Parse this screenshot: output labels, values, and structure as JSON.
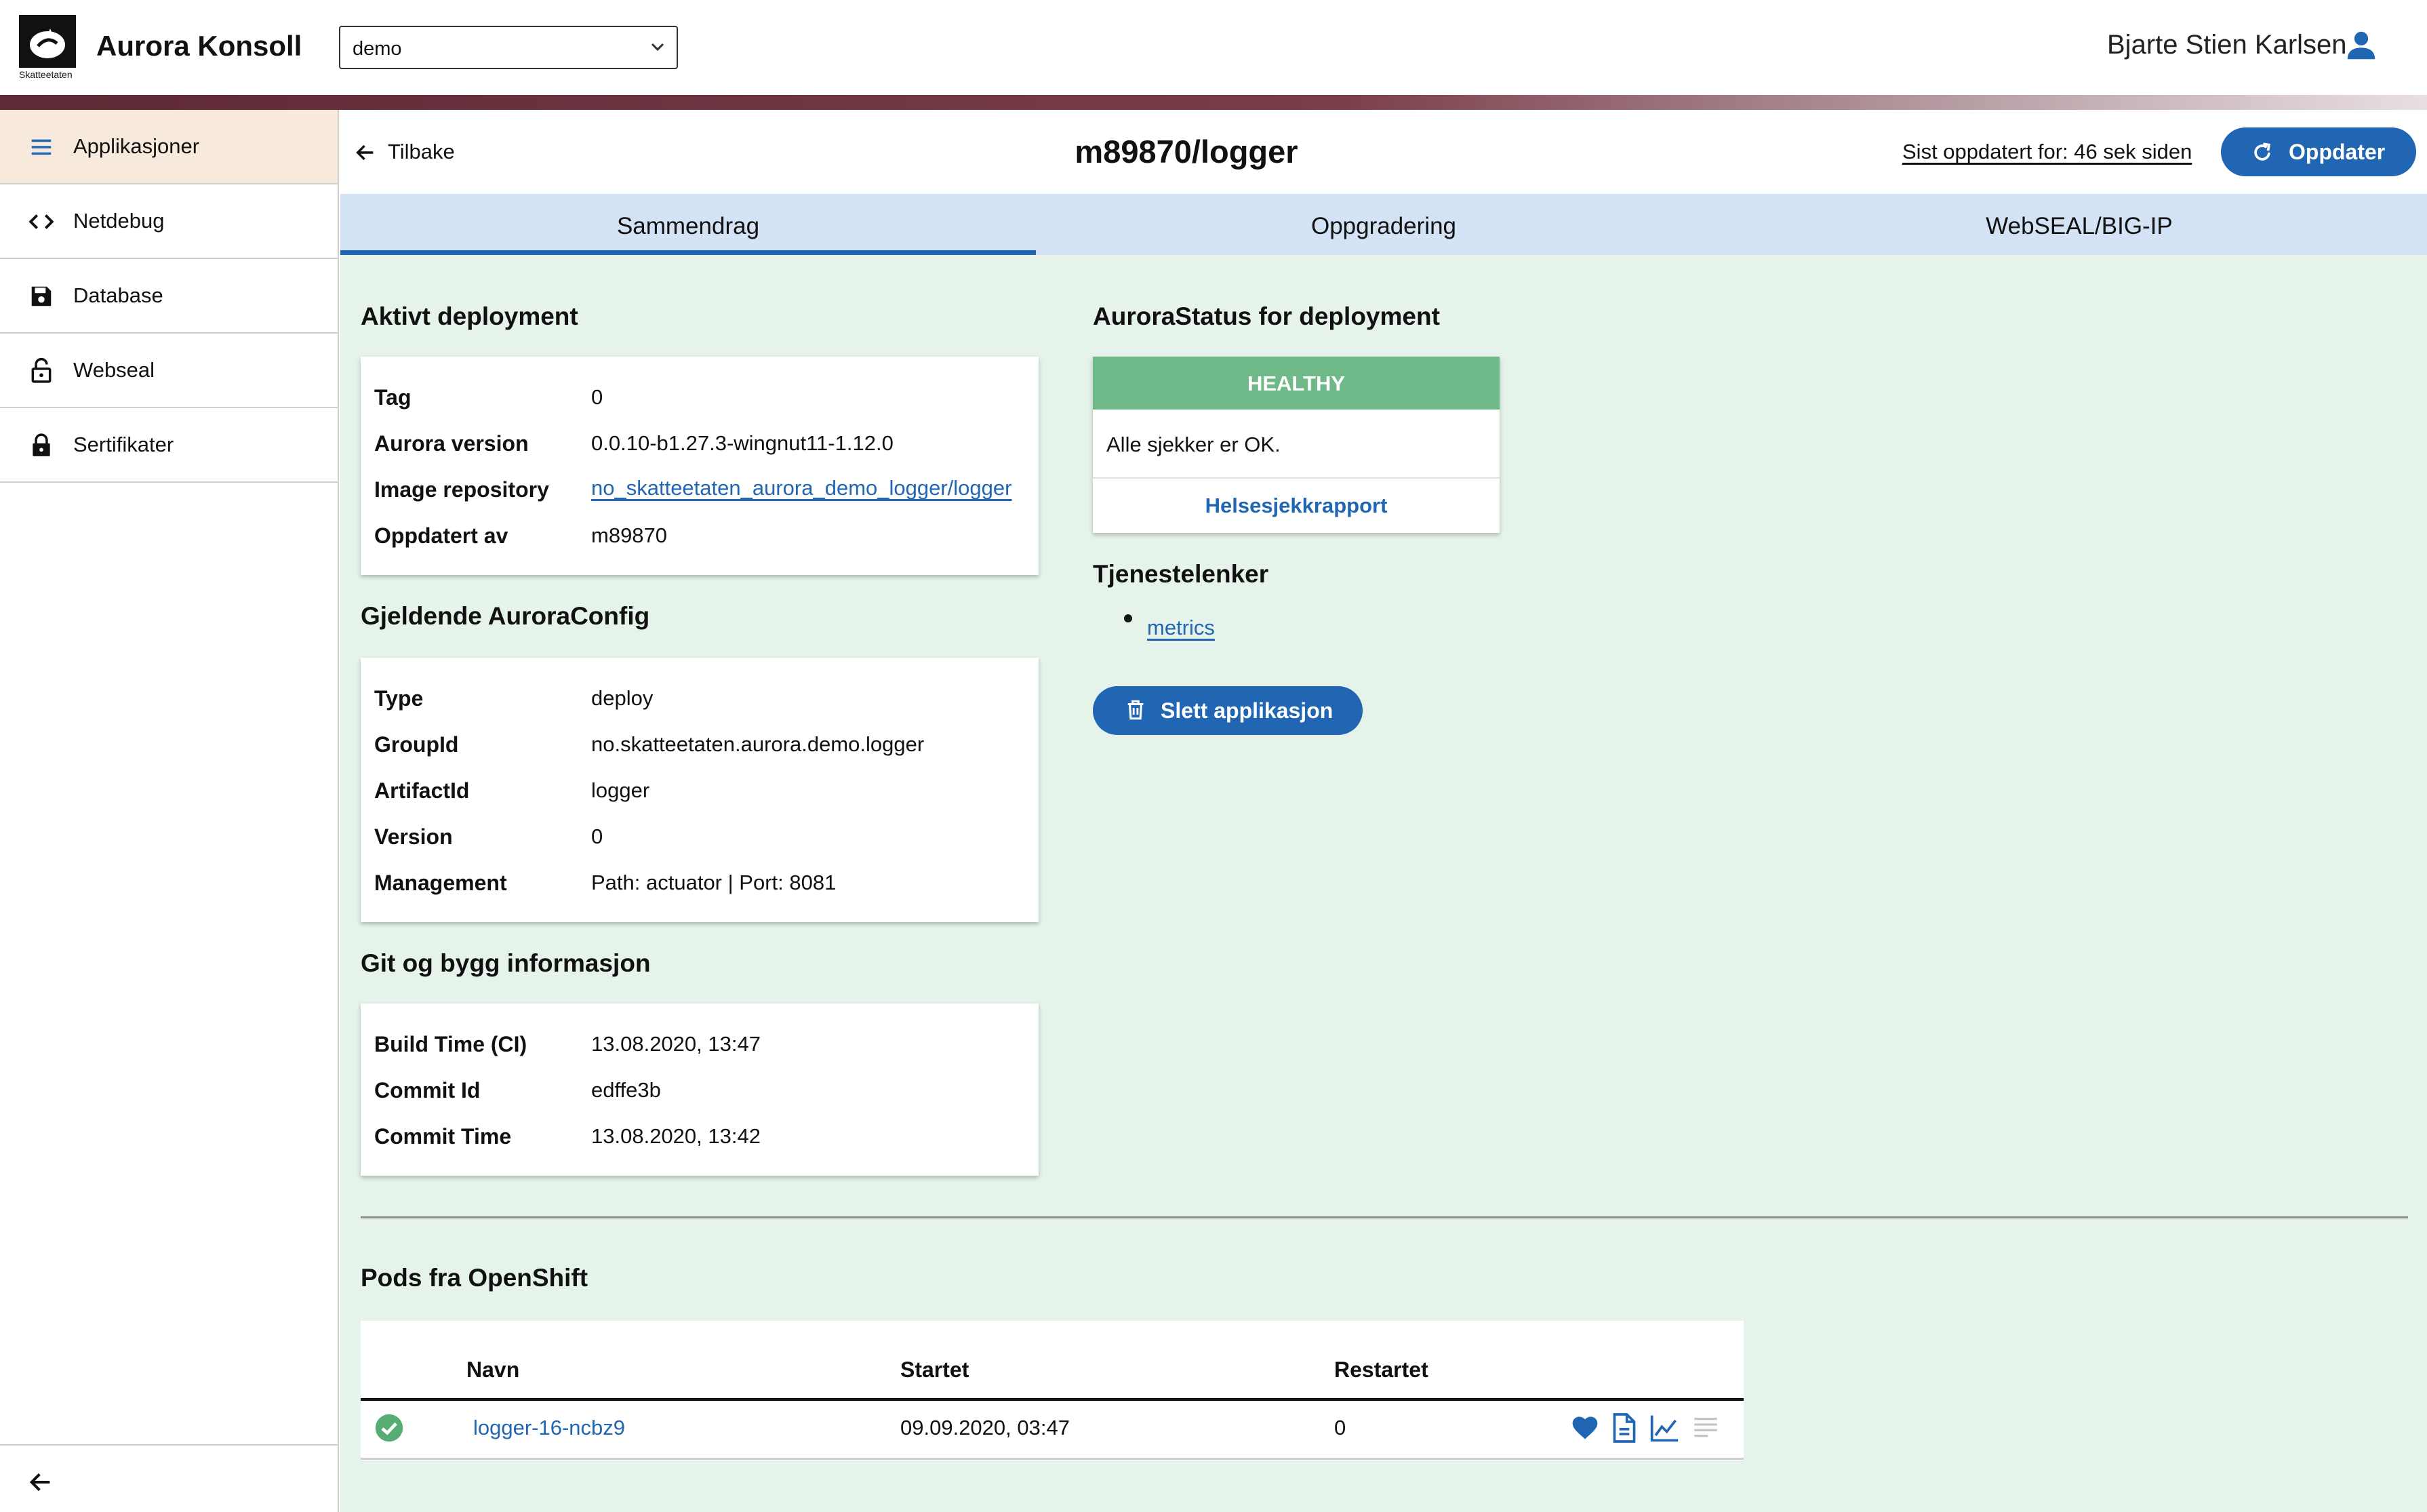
{
  "header": {
    "logo_text": "Skatteetaten",
    "app_title": "Aurora Konsoll",
    "environment": {
      "selected": "demo"
    },
    "user_name": "Bjarte Stien Karlsen"
  },
  "sidebar": {
    "items": [
      {
        "label": "Applikasjoner",
        "icon": "hamburger-menu-icon",
        "active": true
      },
      {
        "label": "Netdebug",
        "icon": "code-brackets-icon",
        "active": false
      },
      {
        "label": "Database",
        "icon": "floppy-disk-icon",
        "active": false
      },
      {
        "label": "Webseal",
        "icon": "unlocked-padlock-icon",
        "active": false
      },
      {
        "label": "Sertifikater",
        "icon": "locked-padlock-icon",
        "active": false
      }
    ],
    "collapse_icon": "arrow-left-icon"
  },
  "content_header": {
    "back_label": "Tilbake",
    "title": "m89870/logger",
    "last_updated": "Sist oppdatert for: 46 sek siden",
    "refresh_label": "Oppdater"
  },
  "tabs": [
    {
      "label": "Sammendrag",
      "active": true
    },
    {
      "label": "Oppgradering",
      "active": false
    },
    {
      "label": "WebSEAL/BIG-IP",
      "active": false
    }
  ],
  "active_deployment": {
    "title": "Aktivt deployment",
    "rows": [
      {
        "key": "Tag",
        "value": "0"
      },
      {
        "key": "Aurora version",
        "value": "0.0.10-b1.27.3-wingnut11-1.12.0"
      },
      {
        "key": "Image repository",
        "value": "no_skatteetaten_aurora_demo_logger/logger"
      },
      {
        "key": "Oppdatert av",
        "value": "m89870"
      }
    ]
  },
  "aurora_config": {
    "title": "Gjeldende AuroraConfig",
    "rows": [
      {
        "key": "Type",
        "value": "deploy"
      },
      {
        "key": "GroupId",
        "value": "no.skatteetaten.aurora.demo.logger"
      },
      {
        "key": "ArtifactId",
        "value": "logger"
      },
      {
        "key": "Version",
        "value": "0"
      },
      {
        "key": "Management",
        "value": "Path: actuator | Port: 8081"
      }
    ]
  },
  "git_build": {
    "title": "Git og bygg informasjon",
    "rows": [
      {
        "key": "Build Time (CI)",
        "value": "13.08.2020, 13:47"
      },
      {
        "key": "Commit Id",
        "value": "edffe3b"
      },
      {
        "key": "Commit Time",
        "value": "13.08.2020, 13:42"
      }
    ]
  },
  "aurora_status": {
    "title": "AuroraStatus for deployment",
    "level": "HEALTHY",
    "level_color": "#6fb887",
    "message": "Alle sjekker er OK.",
    "report_link": "Helsesjekkrapport"
  },
  "service_links": {
    "title": "Tjenestelenker",
    "items": [
      "metrics"
    ]
  },
  "delete_button": "Slett applikasjon",
  "pods": {
    "title": "Pods fra OpenShift",
    "columns": [
      "Navn",
      "Startet",
      "Restartet"
    ],
    "rows": [
      {
        "status_icon": "check-circle-icon",
        "name": "logger-16-ncbz9",
        "started": "09.09.2020, 03:47",
        "restarted": "0",
        "actions": [
          "heart-icon",
          "document-icon",
          "chart-line-icon",
          "text-lines-icon"
        ]
      }
    ]
  },
  "colors": {
    "primary": "#2166b3",
    "tab_background": "#d3e2f5",
    "page_background": "#e5f3ea",
    "active_sidebar": "#f7e9dc",
    "healthy": "#6fb887"
  }
}
